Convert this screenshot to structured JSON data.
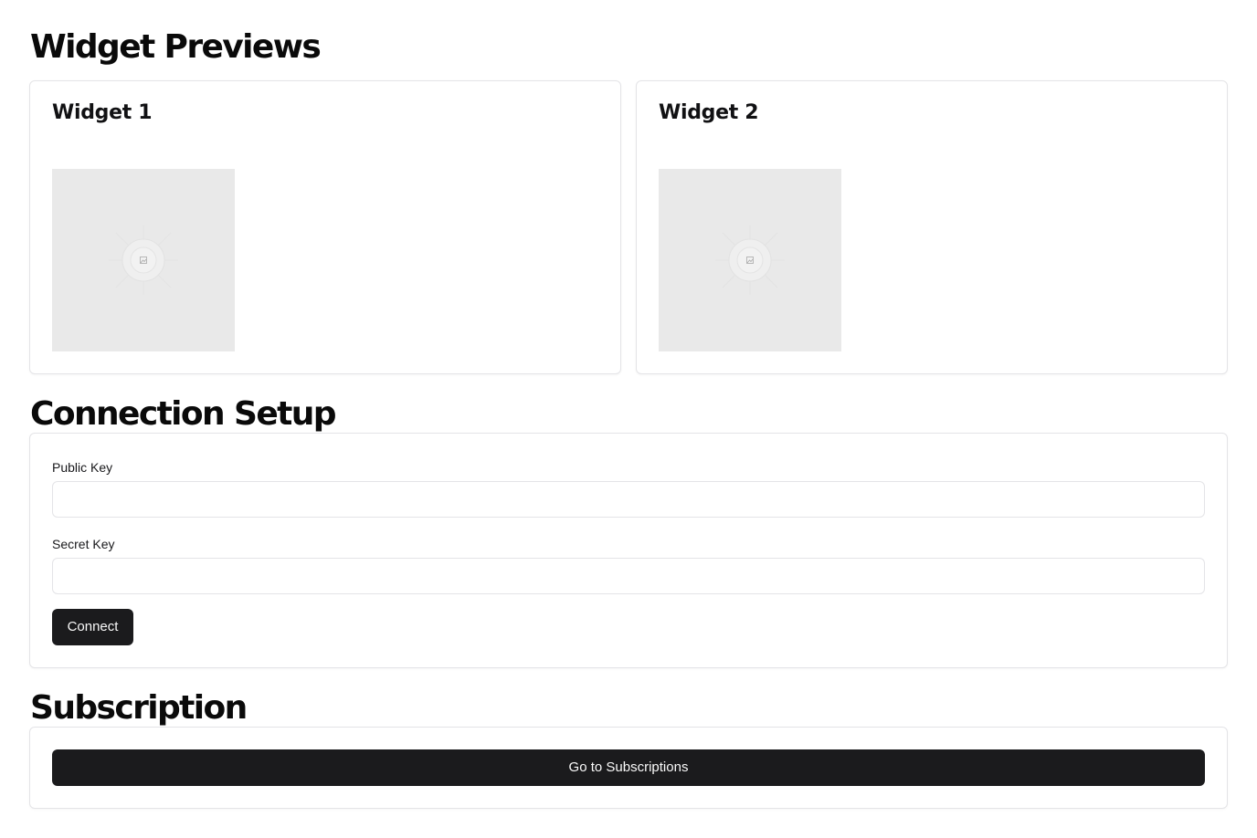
{
  "widget_previews": {
    "heading": "Widget Previews",
    "widgets": [
      {
        "title": "Widget 1",
        "image_icon": "image-placeholder-icon"
      },
      {
        "title": "Widget 2",
        "image_icon": "image-placeholder-icon"
      }
    ]
  },
  "connection_setup": {
    "heading": "Connection Setup",
    "public_key": {
      "label": "Public Key",
      "value": "",
      "placeholder": ""
    },
    "secret_key": {
      "label": "Secret Key",
      "value": "",
      "placeholder": ""
    },
    "connect_label": "Connect"
  },
  "subscription": {
    "heading": "Subscription",
    "button_label": "Go to Subscriptions"
  },
  "colors": {
    "button_bg": "#1b1b1d",
    "button_text": "#fafafa",
    "border": "#e4e4e7",
    "placeholder_bg": "#e9e9e9"
  }
}
